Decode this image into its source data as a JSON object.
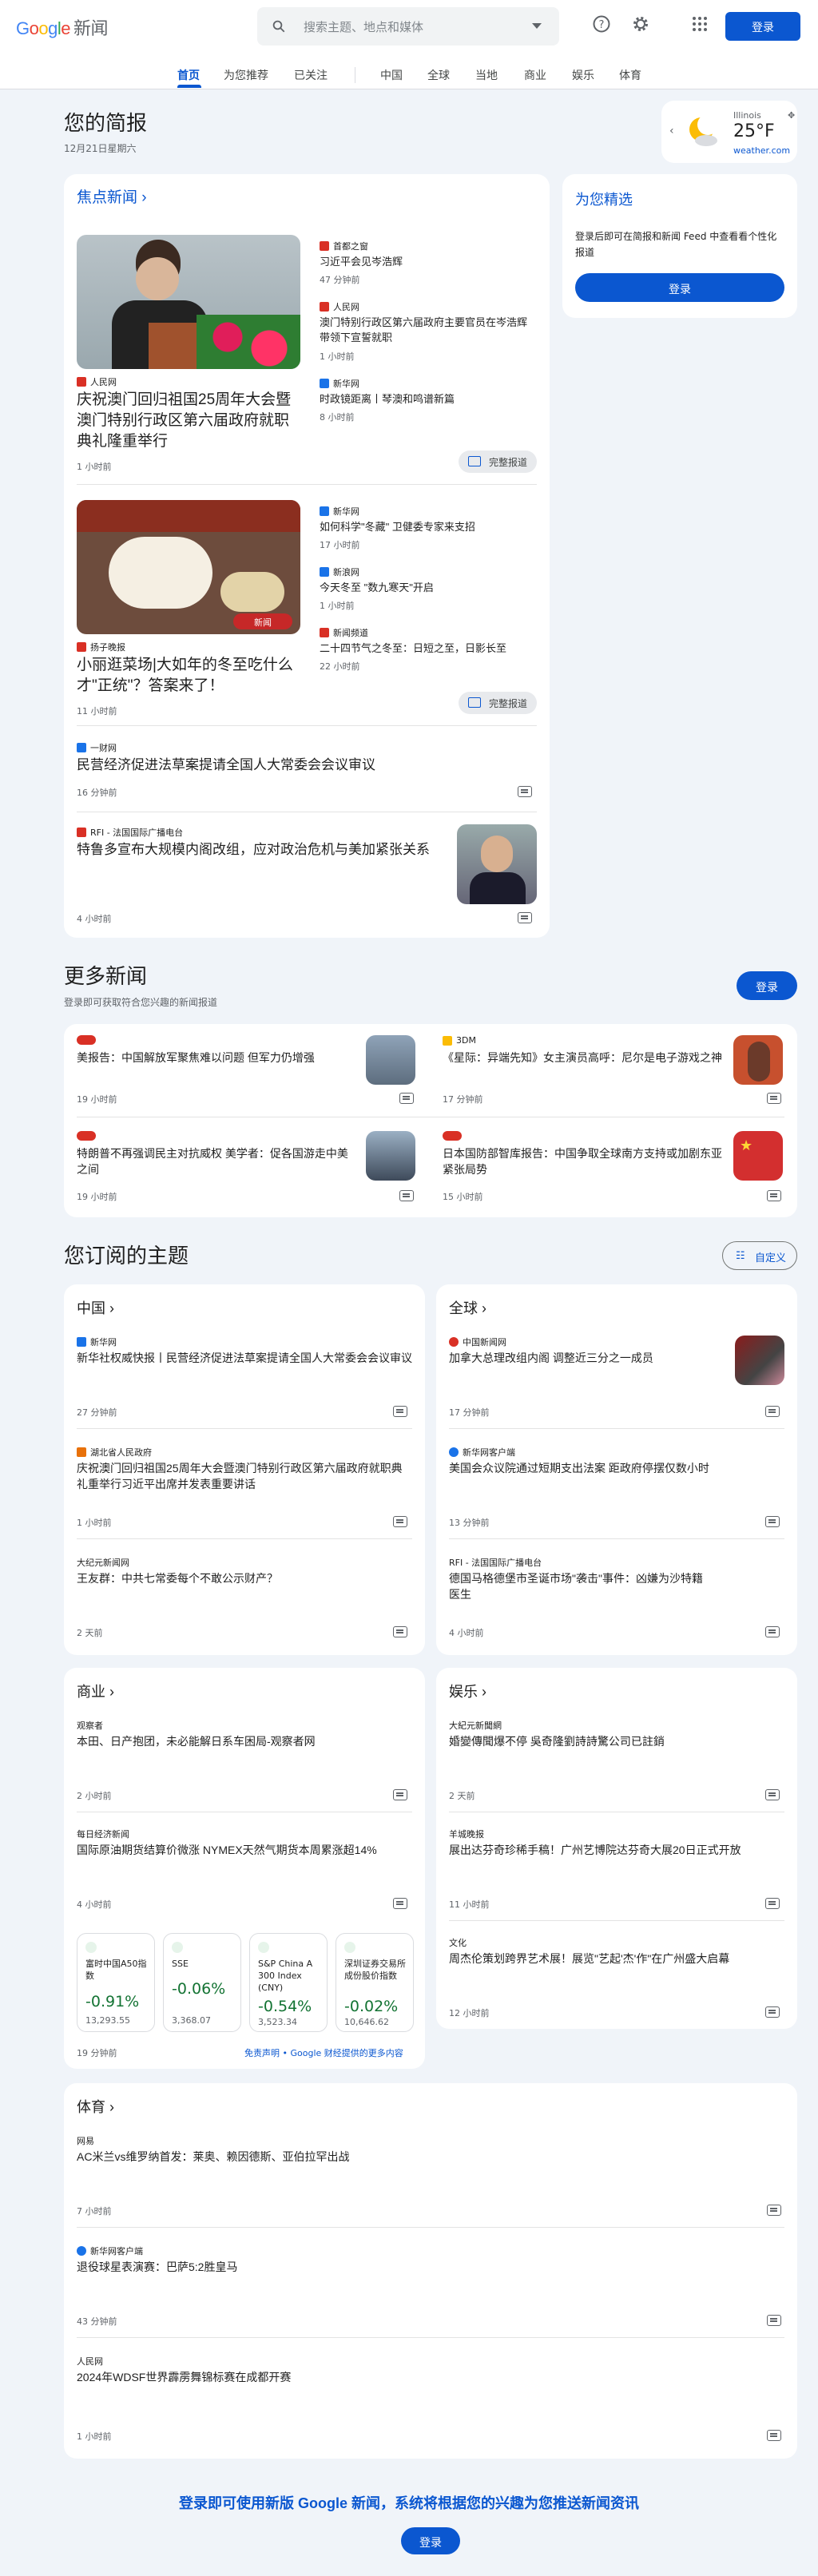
{
  "header": {
    "logo_google": "Google",
    "logo_news": "新闻",
    "search_placeholder": "搜索主题、地点和媒体",
    "signin": "登录"
  },
  "nav": [
    "首页",
    "为您推荐",
    "已关注",
    "中国",
    "全球",
    "当地",
    "商业",
    "娱乐",
    "体育"
  ],
  "briefing": {
    "title": "您的简报",
    "date": "12月21日星期六"
  },
  "weather": {
    "location": "Illinois",
    "temp": "25°F",
    "source": "weather.com"
  },
  "foryou": {
    "title": "为您精选",
    "text": "登录后即可在简报和新闻 Feed 中查看看个性化报道",
    "button": "登录"
  },
  "top": {
    "title": "焦点新闻",
    "full": "完整报道",
    "s1": {
      "src": "人民网",
      "title": "庆祝澳门回归祖国25周年大会暨澳门特别行政区第六届政府就职典礼隆重举行",
      "time": "1 小时前",
      "side": [
        {
          "src": "首都之窗",
          "title": "习近平会见岑浩辉",
          "time": "47 分钟前"
        },
        {
          "src": "人民网",
          "title": "澳门特别行政区第六届政府主要官员在岑浩辉带领下宣誓就职",
          "time": "1 小时前"
        },
        {
          "src": "新华网",
          "title": "时政镜距离丨琴澳和鸣谱新篇",
          "time": "8 小时前"
        }
      ]
    },
    "s2": {
      "src": "扬子晚报",
      "title": "小丽逛菜场|大如年的冬至吃什么才\"正统\"？答案来了！",
      "time": "11 小时前",
      "img_text": "新闻",
      "side": [
        {
          "src": "新华网",
          "title": "如何科学\"冬藏\" 卫健委专家来支招",
          "time": "17 小时前"
        },
        {
          "src": "新浪网",
          "title": "今天冬至 \"数九寒天\"开启",
          "time": "1 小时前"
        },
        {
          "src": "新闻频道",
          "title": "二十四节气之冬至：日短之至，日影长至",
          "time": "22 小时前"
        }
      ]
    },
    "s3": {
      "src": "一财网",
      "title": "民营经济促进法草案提请全国人大常委会会议审议",
      "time": "16 分钟前"
    },
    "s4": {
      "src": "RFI - 法国国际广播电台",
      "title": "特鲁多宣布大规模内阁改组，应对政治危机与美加紧张关系",
      "time": "4 小时前"
    }
  },
  "more": {
    "title": "更多新闻",
    "sub": "登录即可获取符合您兴趣的新闻报道",
    "button": "登录",
    "items": [
      {
        "src": "",
        "title": "美报告：中国解放军聚焦难以问题 但军力仍增强",
        "time": "19 小时前"
      },
      {
        "src": "3DM",
        "title": "《星际：异端先知》女主演员高呼：尼尔是电子游戏之神",
        "time": "17 分钟前"
      },
      {
        "src": "",
        "title": "特朗普不再强调民主对抗威权 美学者：促各国游走中美之间",
        "time": "19 小时前"
      },
      {
        "src": "",
        "title": "日本国防部智库报告：中国争取全球南方支持或加剧东亚紧张局势",
        "time": "15 小时前"
      }
    ]
  },
  "topics": {
    "title": "您订阅的主题",
    "custom": "自定义",
    "china": {
      "title": "中国",
      "items": [
        {
          "src": "新华网",
          "title": "新华社权威快报丨民营经济促进法草案提请全国人大常委会会议审议",
          "time": "27 分钟前"
        },
        {
          "src": "湖北省人民政府",
          "title": "庆祝澳门回归祖国25周年大会暨澳门特别行政区第六届政府就职典礼重举行习近平出席并发表重要讲话",
          "time": "1 小时前"
        },
        {
          "src": "大纪元新闻网",
          "title": "王友群：中共七常委每个不敢公示财产？",
          "time": "2 天前"
        }
      ]
    },
    "world": {
      "title": "全球",
      "items": [
        {
          "src": "中国新闻网",
          "title": "加拿大总理改组内阁 调整近三分之一成员",
          "time": "17 分钟前"
        },
        {
          "src": "新华网客户端",
          "title": "美国会众议院通过短期支出法案 距政府停摆仅数小时",
          "time": "13 分钟前"
        },
        {
          "src": "RFI - 法国国际广播电台",
          "title": "德国马格德堡市圣诞市场\"袭击\"事件：凶嫌为沙特籍医生",
          "time": "4 小时前"
        }
      ]
    },
    "biz": {
      "title": "商业",
      "items": [
        {
          "src": "观察者",
          "title": "本田、日产抱团，未必能解日系车困局-观察者网",
          "time": "2 小时前"
        },
        {
          "src": "每日经济新闻",
          "title": "国际原油期货结算价微涨 NYMEX天然气期货本周累涨超14%",
          "time": "4 小时前"
        }
      ],
      "stocks": [
        {
          "name": "富时中国A50指数",
          "pct": "-0.91%",
          "val": "13,293.55"
        },
        {
          "name": "SSE",
          "pct": "-0.06%",
          "val": "3,368.07"
        },
        {
          "name": "S&P China A 300 Index (CNY)",
          "pct": "-0.54%",
          "val": "3,523.34"
        },
        {
          "name": "深圳证券交易所成份股价指数",
          "pct": "-0.02%",
          "val": "10,646.62"
        }
      ],
      "time": "19 分钟前",
      "disclaimer": "免责声明 • Google 财经提供的更多内容"
    },
    "ent": {
      "title": "娱乐",
      "items": [
        {
          "src": "大紀元新聞網",
          "title": "婚變傳聞爆不停 吳奇隆劉詩詩驚公司已註銷",
          "time": "2 天前"
        },
        {
          "src": "羊城晚报",
          "title": "展出达芬奇珍稀手稿！广州艺博院达芬奇大展20日正式开放",
          "time": "11 小时前"
        },
        {
          "src": "文化",
          "title": "周杰伦策划跨界艺术展！展览\"艺起'杰'作\"在广州盛大启幕",
          "time": "12 小时前"
        }
      ]
    },
    "sports": {
      "title": "体育",
      "items": [
        {
          "src": "网易",
          "title": "AC米兰vs维罗纳首发：莱奥、赖因德斯、亚伯拉罕出战",
          "time": "7 小时前"
        },
        {
          "src": "新华网客户端",
          "title": "退役球星表演赛：巴萨5:2胜皇马",
          "time": "43 分钟前"
        },
        {
          "src": "人民网",
          "title": "2024年WDSF世界霹雳舞锦标赛在成都开赛",
          "time": "1 小时前"
        }
      ]
    }
  },
  "footer": {
    "text": "登录即可使用新版 Google 新闻，系统将根据您的兴趣为您推送新闻资讯",
    "button": "登录"
  },
  "colors": {
    "accent": "#0b57d0",
    "down": "#137333"
  }
}
